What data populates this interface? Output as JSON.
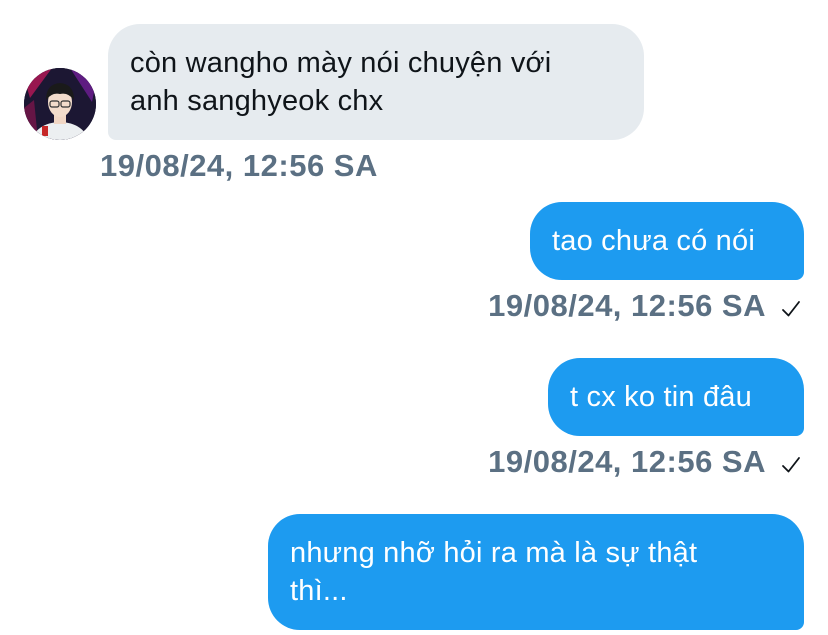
{
  "conversation": {
    "messages": [
      {
        "direction": "incoming",
        "text_line1": "còn wangho mày nói chuyện với",
        "text_line2": "anh sanghyeok chx",
        "timestamp": "19/08/24, 12:56 SA"
      },
      {
        "direction": "outgoing",
        "text": "tao chưa có nói",
        "timestamp": "19/08/24, 12:56 SA",
        "status_icon": "check-icon"
      },
      {
        "direction": "outgoing",
        "text": "t cx ko tin đâu",
        "timestamp": "19/08/24, 12:56 SA",
        "status_icon": "check-icon"
      },
      {
        "direction": "outgoing",
        "text_line1": "nhưng nhỡ hỏi ra mà là sự thật",
        "text_line2": "thì..."
      }
    ]
  },
  "theme": {
    "incoming_bubble": "#e6ebef",
    "outgoing_bubble": "#1d9bf0",
    "timestamp_color": "#5b7083"
  }
}
